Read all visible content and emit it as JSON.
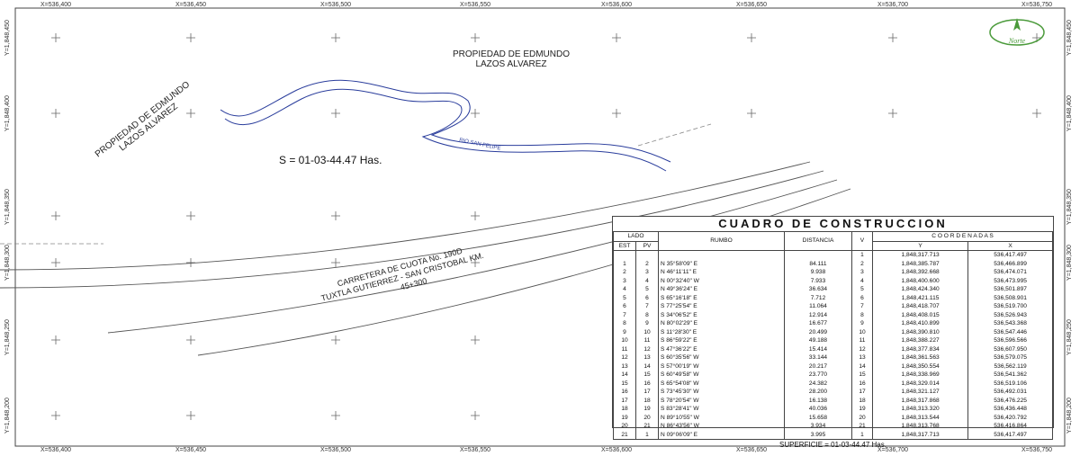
{
  "frame": {
    "x_ticks": [
      "X=536,400",
      "X=536,450",
      "X=536,500",
      "X=536,550",
      "X=536,600",
      "X=536,650",
      "X=536,700",
      "X=536,750"
    ],
    "y_ticks": [
      "Y=1,848,450",
      "Y=1,848,400",
      "Y=1,848,350",
      "Y=1,848,300",
      "Y=1,848,250",
      "Y=1,848,200"
    ]
  },
  "labels": {
    "north_owner_line1": "PROPIEDAD DE EDMUNDO",
    "north_owner_line2": "LAZOS ALVAREZ",
    "west_owner_line1": "PROPIEDAD DE EDMUNDO",
    "west_owner_line2": "LAZOS ALVAREZ",
    "area": "S = 01-03-44.47 Has.",
    "river": "RIO SAN FELIPE",
    "road_line1": "CARRETERA DE CUOTA No. 190D",
    "road_line2": "TUXTLA GUTIERREZ - SAN CRISTOBAL KM.",
    "road_line3": "45+300",
    "logo_text": "Norte"
  },
  "vertex_labels": [
    "1",
    "2",
    "3",
    "4",
    "5",
    "6",
    "7",
    "8",
    "9",
    "10",
    "11",
    "12",
    "13",
    "14",
    "15",
    "16",
    "17",
    "18",
    "19",
    "20",
    "21"
  ],
  "table": {
    "title": "CUADRO DE CONSTRUCCION",
    "headers": {
      "lado": "LADO",
      "est": "EST",
      "pv": "PV",
      "rumbo": "RUMBO",
      "distancia": "DISTANCIA",
      "v": "V",
      "coordenadas": "C O O R D E N A D A S",
      "y": "Y",
      "x": "X"
    },
    "first_row": {
      "v": "1",
      "y": "1,848,317.713",
      "x": "536,417.497"
    },
    "rows": [
      {
        "est": "1",
        "pv": "2",
        "rumbo": "N 35°58'09\" E",
        "dist": "84.111",
        "v": "2",
        "y": "1,848,385.787",
        "x": "536,466.899"
      },
      {
        "est": "2",
        "pv": "3",
        "rumbo": "N 46°11'11\" E",
        "dist": "9.938",
        "v": "3",
        "y": "1,848,392.668",
        "x": "536,474.071"
      },
      {
        "est": "3",
        "pv": "4",
        "rumbo": "N 00°32'40\" W",
        "dist": "7.933",
        "v": "4",
        "y": "1,848,400.600",
        "x": "536,473.995"
      },
      {
        "est": "4",
        "pv": "5",
        "rumbo": "N 49°36'24\" E",
        "dist": "36.634",
        "v": "5",
        "y": "1,848,424.340",
        "x": "536,501.897"
      },
      {
        "est": "5",
        "pv": "6",
        "rumbo": "S 65°16'18\" E",
        "dist": "7.712",
        "v": "6",
        "y": "1,848,421.115",
        "x": "536,508.901"
      },
      {
        "est": "6",
        "pv": "7",
        "rumbo": "S 77°25'54\" E",
        "dist": "11.064",
        "v": "7",
        "y": "1,848,418.707",
        "x": "536,519.700"
      },
      {
        "est": "7",
        "pv": "8",
        "rumbo": "S 34°06'52\" E",
        "dist": "12.914",
        "v": "8",
        "y": "1,848,408.015",
        "x": "536,526.943"
      },
      {
        "est": "8",
        "pv": "9",
        "rumbo": "N 80°02'29\" E",
        "dist": "16.677",
        "v": "9",
        "y": "1,848,410.899",
        "x": "536,543.368"
      },
      {
        "est": "9",
        "pv": "10",
        "rumbo": "S 11°28'30\" E",
        "dist": "20.499",
        "v": "10",
        "y": "1,848,390.810",
        "x": "536,547.446"
      },
      {
        "est": "10",
        "pv": "11",
        "rumbo": "S 86°59'22\" E",
        "dist": "49.188",
        "v": "11",
        "y": "1,848,388.227",
        "x": "536,596.566"
      },
      {
        "est": "11",
        "pv": "12",
        "rumbo": "S 47°36'22\" E",
        "dist": "15.414",
        "v": "12",
        "y": "1,848,377.834",
        "x": "536,607.950"
      },
      {
        "est": "12",
        "pv": "13",
        "rumbo": "S 60°35'56\" W",
        "dist": "33.144",
        "v": "13",
        "y": "1,848,361.563",
        "x": "536,579.075"
      },
      {
        "est": "13",
        "pv": "14",
        "rumbo": "S 57°00'19\" W",
        "dist": "20.217",
        "v": "14",
        "y": "1,848,350.554",
        "x": "536,562.119"
      },
      {
        "est": "14",
        "pv": "15",
        "rumbo": "S 60°49'58\" W",
        "dist": "23.770",
        "v": "15",
        "y": "1,848,338.969",
        "x": "536,541.362"
      },
      {
        "est": "15",
        "pv": "16",
        "rumbo": "S 65°54'08\" W",
        "dist": "24.382",
        "v": "16",
        "y": "1,848,329.014",
        "x": "536,519.106"
      },
      {
        "est": "16",
        "pv": "17",
        "rumbo": "S 73°45'30\" W",
        "dist": "28.200",
        "v": "17",
        "y": "1,848,321.127",
        "x": "536,492.031"
      },
      {
        "est": "17",
        "pv": "18",
        "rumbo": "S 78°20'54\" W",
        "dist": "16.138",
        "v": "18",
        "y": "1,848,317.868",
        "x": "536,476.225"
      },
      {
        "est": "18",
        "pv": "19",
        "rumbo": "S 83°28'41\" W",
        "dist": "40.036",
        "v": "19",
        "y": "1,848,313.320",
        "x": "536,436.448"
      },
      {
        "est": "19",
        "pv": "20",
        "rumbo": "N 89°10'55\" W",
        "dist": "15.658",
        "v": "20",
        "y": "1,848,313.544",
        "x": "536,420.792"
      },
      {
        "est": "20",
        "pv": "21",
        "rumbo": "N 86°43'56\" W",
        "dist": "3.934",
        "v": "21",
        "y": "1,848,313.768",
        "x": "536,416.864"
      },
      {
        "est": "21",
        "pv": "1",
        "rumbo": "N 09°06'09\" E",
        "dist": "3.995",
        "v": "1",
        "y": "1,848,317.713",
        "x": "536,417.497"
      }
    ],
    "superficie": "SUPERFICIE = 01-03-44.47 Has."
  },
  "colors": {
    "boundary": "#222222",
    "vertex": "#cc2222",
    "river": "#2a3d9c",
    "logo": "#4a9a3a"
  }
}
